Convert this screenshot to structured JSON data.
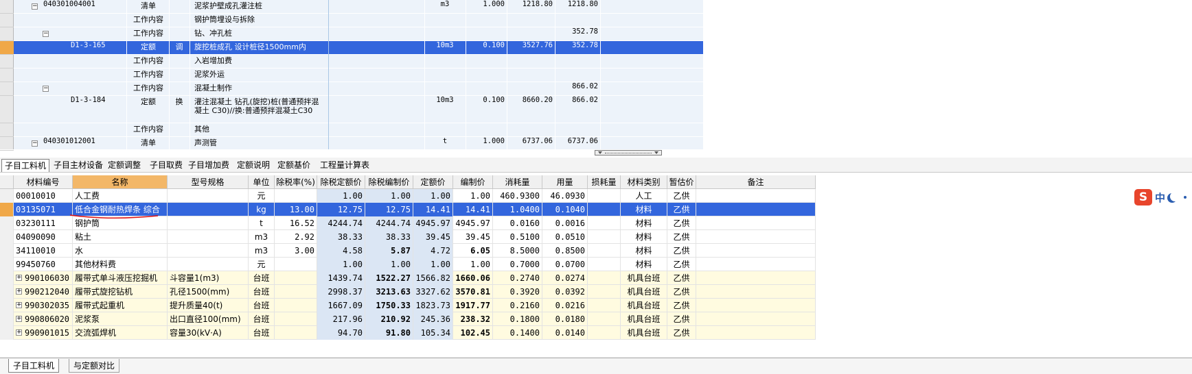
{
  "top_rows": [
    {
      "code": "040301004001",
      "type": "清单",
      "flag": "",
      "name": "泥浆护壁成孔灌注桩",
      "unit": "m3",
      "qty": "1.000",
      "price": "1218.80",
      "total": "1218.80",
      "level": 0,
      "toggle": "minus"
    },
    {
      "code": "",
      "type": "工作内容",
      "flag": "",
      "name": "钢护筒埋设与拆除",
      "unit": "",
      "qty": "",
      "price": "",
      "total": "",
      "level": 1,
      "toggle": ""
    },
    {
      "code": "",
      "type": "工作内容",
      "flag": "",
      "name": "钻、冲孔桩",
      "unit": "",
      "qty": "",
      "price": "",
      "total": "352.78",
      "level": 1,
      "toggle": "minus"
    },
    {
      "code": "D1-3-165",
      "type": "定额",
      "flag": "调",
      "name": "旋挖桩成孔 设计桩径1500mm内",
      "unit": "10m3",
      "qty": "0.100",
      "price": "3527.76",
      "total": "352.78",
      "level": 2,
      "toggle": "",
      "selected": true
    },
    {
      "code": "",
      "type": "工作内容",
      "flag": "",
      "name": "入岩增加费",
      "unit": "",
      "qty": "",
      "price": "",
      "total": "",
      "level": 1,
      "toggle": ""
    },
    {
      "code": "",
      "type": "工作内容",
      "flag": "",
      "name": "泥浆外运",
      "unit": "",
      "qty": "",
      "price": "",
      "total": "",
      "level": 1,
      "toggle": ""
    },
    {
      "code": "",
      "type": "工作内容",
      "flag": "",
      "name": "混凝土制作",
      "unit": "",
      "qty": "",
      "price": "",
      "total": "866.02",
      "level": 1,
      "toggle": "minus"
    },
    {
      "code": "D1-3-184",
      "type": "定额",
      "flag": "换",
      "name": "灌注混凝土 钻孔(旋挖)桩(普通预拌混凝土 C30)//换:普通预拌混凝土C30",
      "unit": "10m3",
      "qty": "0.100",
      "price": "8660.20",
      "total": "866.02",
      "level": 2,
      "toggle": "",
      "tall": true
    },
    {
      "code": "",
      "type": "工作内容",
      "flag": "",
      "name": "其他",
      "unit": "",
      "qty": "",
      "price": "",
      "total": "",
      "level": 1,
      "toggle": ""
    },
    {
      "code": "040301012001",
      "type": "清单",
      "flag": "",
      "name": "声测管",
      "unit": "t",
      "qty": "1.000",
      "price": "6737.06",
      "total": "6737.06",
      "level": 0,
      "toggle": "minus"
    }
  ],
  "tabs": [
    "子目工料机",
    "子目主材设备",
    "定额调整",
    "子目取费",
    "子目增加费",
    "定额说明",
    "定额基价",
    "工程量计算表"
  ],
  "columns": [
    "材料编号",
    "名称",
    "型号规格",
    "单位",
    "除税率(%)",
    "除税定额价",
    "除税编制价",
    "定额价",
    "编制价",
    "消耗量",
    "用量",
    "损耗量",
    "材料类别",
    "暂估价",
    "备注"
  ],
  "rows": [
    {
      "code": "00010010",
      "name": "人工费",
      "spec": "",
      "unit": "元",
      "rate": "",
      "p1": "1.00",
      "p2": "1.00",
      "p3": "1.00",
      "p4": "1.00",
      "cons": "460.9300",
      "use": "46.0930",
      "loss": "",
      "cat": "人工",
      "est": "乙供",
      "note": "",
      "kind": "white"
    },
    {
      "code": "03135071",
      "name": "低合金钢耐热焊条 综合",
      "spec": "",
      "unit": "kg",
      "rate": "13.00",
      "p1": "12.75",
      "p2": "12.75",
      "p3": "14.41",
      "p4": "14.41",
      "cons": "1.0400",
      "use": "0.1040",
      "loss": "",
      "cat": "材料",
      "est": "乙供",
      "note": "",
      "kind": "sel"
    },
    {
      "code": "03230111",
      "name": "钢护筒",
      "spec": "",
      "unit": "t",
      "rate": "16.52",
      "p1": "4244.74",
      "p2": "4244.74",
      "p3": "4945.97",
      "p4": "4945.97",
      "cons": "0.0160",
      "use": "0.0016",
      "loss": "",
      "cat": "材料",
      "est": "乙供",
      "note": "",
      "kind": "white"
    },
    {
      "code": "04090090",
      "name": "粘土",
      "spec": "",
      "unit": "m3",
      "rate": "2.92",
      "p1": "38.33",
      "p2": "38.33",
      "p3": "39.45",
      "p4": "39.45",
      "cons": "0.5100",
      "use": "0.0510",
      "loss": "",
      "cat": "材料",
      "est": "乙供",
      "note": "",
      "kind": "white"
    },
    {
      "code": "34110010",
      "name": "水",
      "spec": "",
      "unit": "m3",
      "rate": "3.00",
      "p1": "4.58",
      "p2": "5.87",
      "p3": "4.72",
      "p4": "6.05",
      "cons": "8.5000",
      "use": "0.8500",
      "loss": "",
      "cat": "材料",
      "est": "乙供",
      "note": "",
      "kind": "white",
      "bold": true
    },
    {
      "code": "99450760",
      "name": "其他材料费",
      "spec": "",
      "unit": "元",
      "rate": "",
      "p1": "1.00",
      "p2": "1.00",
      "p3": "1.00",
      "p4": "1.00",
      "cons": "0.7000",
      "use": "0.0700",
      "loss": "",
      "cat": "材料",
      "est": "乙供",
      "note": "",
      "kind": "white"
    },
    {
      "code": "990106030",
      "name": "履带式单斗液压挖掘机",
      "spec": "斗容量1(m3)",
      "unit": "台班",
      "rate": "",
      "p1": "1439.74",
      "p2": "1522.27",
      "p3": "1566.82",
      "p4": "1660.06",
      "cons": "0.2740",
      "use": "0.0274",
      "loss": "",
      "cat": "机具台班",
      "est": "乙供",
      "note": "",
      "kind": "yel",
      "plus": true,
      "bold": true
    },
    {
      "code": "990212040",
      "name": "履带式旋挖钻机",
      "spec": "孔径1500(mm)",
      "unit": "台班",
      "rate": "",
      "p1": "2998.37",
      "p2": "3213.63",
      "p3": "3327.62",
      "p4": "3570.81",
      "cons": "0.3920",
      "use": "0.0392",
      "loss": "",
      "cat": "机具台班",
      "est": "乙供",
      "note": "",
      "kind": "yel",
      "plus": true,
      "bold": true
    },
    {
      "code": "990302035",
      "name": "履带式起重机",
      "spec": "提升质量40(t)",
      "unit": "台班",
      "rate": "",
      "p1": "1667.09",
      "p2": "1750.33",
      "p3": "1823.73",
      "p4": "1917.77",
      "cons": "0.2160",
      "use": "0.0216",
      "loss": "",
      "cat": "机具台班",
      "est": "乙供",
      "note": "",
      "kind": "yel",
      "plus": true,
      "bold": true
    },
    {
      "code": "990806020",
      "name": "泥浆泵",
      "spec": "出口直径100(mm)",
      "unit": "台班",
      "rate": "",
      "p1": "217.96",
      "p2": "210.92",
      "p3": "245.36",
      "p4": "238.32",
      "cons": "0.1800",
      "use": "0.0180",
      "loss": "",
      "cat": "机具台班",
      "est": "乙供",
      "note": "",
      "kind": "yel",
      "plus": true,
      "bold": true
    },
    {
      "code": "990901015",
      "name": "交流弧焊机",
      "spec": "容量30(kV·A)",
      "unit": "台班",
      "rate": "",
      "p1": "94.70",
      "p2": "91.80",
      "p3": "105.34",
      "p4": "102.45",
      "cons": "0.1400",
      "use": "0.0140",
      "loss": "",
      "cat": "机具台班",
      "est": "乙供",
      "note": "",
      "kind": "yel",
      "plus": true,
      "bold": true
    }
  ],
  "bottom_tabs": [
    "子目工料机",
    "与定额对比"
  ],
  "ime": {
    "logo": "S",
    "lang": "中"
  },
  "colors": {
    "selection": "#3366dd",
    "header_orange": "#f3b768",
    "price_blue": "#dbe6f4",
    "machine_yellow": "#fffbe0"
  }
}
